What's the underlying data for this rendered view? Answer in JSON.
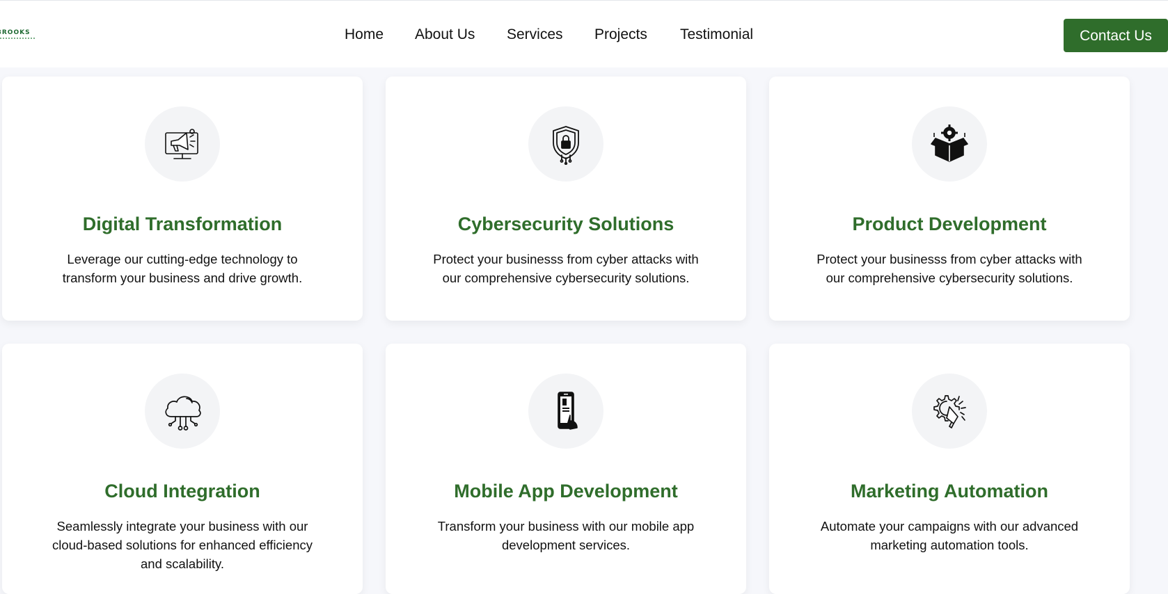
{
  "header": {
    "logo_text": "BROOKS",
    "nav": [
      "Home",
      "About Us",
      "Services",
      "Projects",
      "Testimonial"
    ],
    "contact_label": "Contact Us",
    "accent_color": "#2f6d2b"
  },
  "services": [
    {
      "icon": "megaphone-monitor-icon",
      "title": "Digital Transformation",
      "description": "Leverage our cutting-edge technology to transform your business and drive growth."
    },
    {
      "icon": "shield-lock-icon",
      "title": "Cybersecurity Solutions",
      "description": "Protect your businesss from cyber attacks with our comprehensive cybersecurity solutions."
    },
    {
      "icon": "gear-box-icon",
      "title": "Product Development",
      "description": "Protect your businesss from cyber attacks with our comprehensive cybersecurity solutions."
    },
    {
      "icon": "cloud-network-icon",
      "title": "Cloud Integration",
      "description": "Seamlessly integrate your business with our cloud-based solutions for enhanced efficiency and scalability."
    },
    {
      "icon": "mobile-phone-icon",
      "title": "Mobile App Development",
      "description": "Transform your business with our mobile app development services."
    },
    {
      "icon": "gear-megaphone-icon",
      "title": "Marketing Automation",
      "description": "Automate your campaigns with our advanced marketing automation tools."
    }
  ]
}
